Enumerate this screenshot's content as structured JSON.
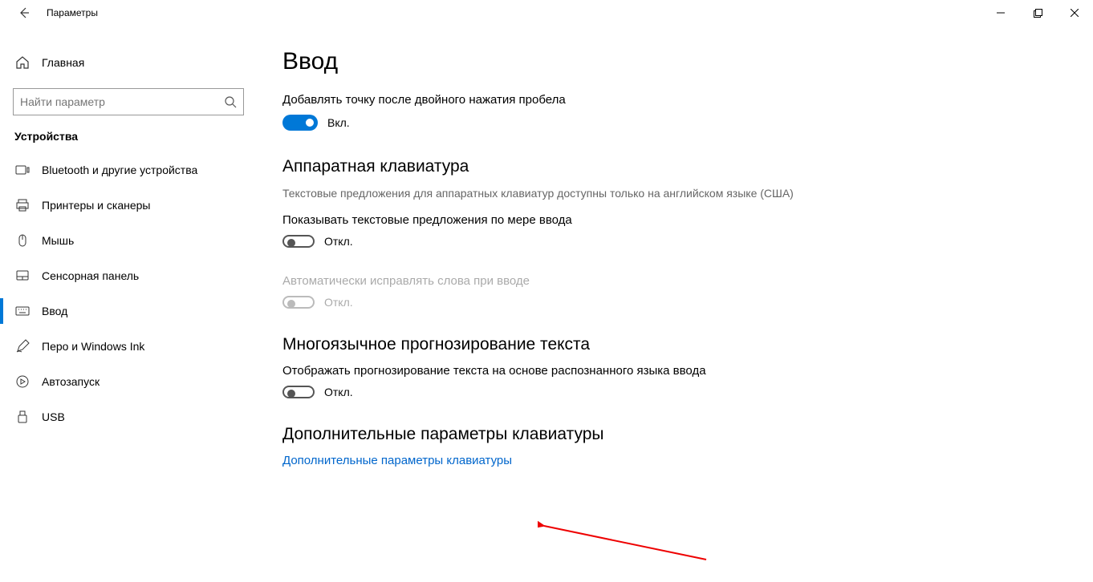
{
  "window": {
    "title": "Параметры"
  },
  "sidebar": {
    "home_label": "Главная",
    "search_placeholder": "Найти параметр",
    "category": "Устройства",
    "items": [
      {
        "label": "Bluetooth и другие устройства",
        "icon": "bluetooth"
      },
      {
        "label": "Принтеры и сканеры",
        "icon": "printer"
      },
      {
        "label": "Мышь",
        "icon": "mouse"
      },
      {
        "label": "Сенсорная панель",
        "icon": "touchpad"
      },
      {
        "label": "Ввод",
        "icon": "keyboard",
        "active": true
      },
      {
        "label": "Перо и Windows Ink",
        "icon": "pen"
      },
      {
        "label": "Автозапуск",
        "icon": "autoplay"
      },
      {
        "label": "USB",
        "icon": "usb"
      }
    ]
  },
  "main": {
    "title": "Ввод",
    "double_space": {
      "label": "Добавлять точку после двойного нажатия пробела",
      "state_text": "Вкл."
    },
    "hw_keyboard": {
      "title": "Аппаратная клавиатура",
      "desc": "Текстовые предложения для аппаратных клавиатур доступны только на английском языке (США)",
      "suggestions_label": "Показывать текстовые предложения по мере ввода",
      "suggestions_state": "Откл.",
      "autocorrect_label": "Автоматически исправлять слова при вводе",
      "autocorrect_state": "Откл."
    },
    "multilang": {
      "title": "Многоязычное прогнозирование текста",
      "desc": "Отображать прогнозирование текста на основе распознанного языка ввода",
      "state": "Откл."
    },
    "advanced": {
      "title": "Дополнительные параметры клавиатуры",
      "link": "Дополнительные параметры клавиатуры"
    }
  }
}
